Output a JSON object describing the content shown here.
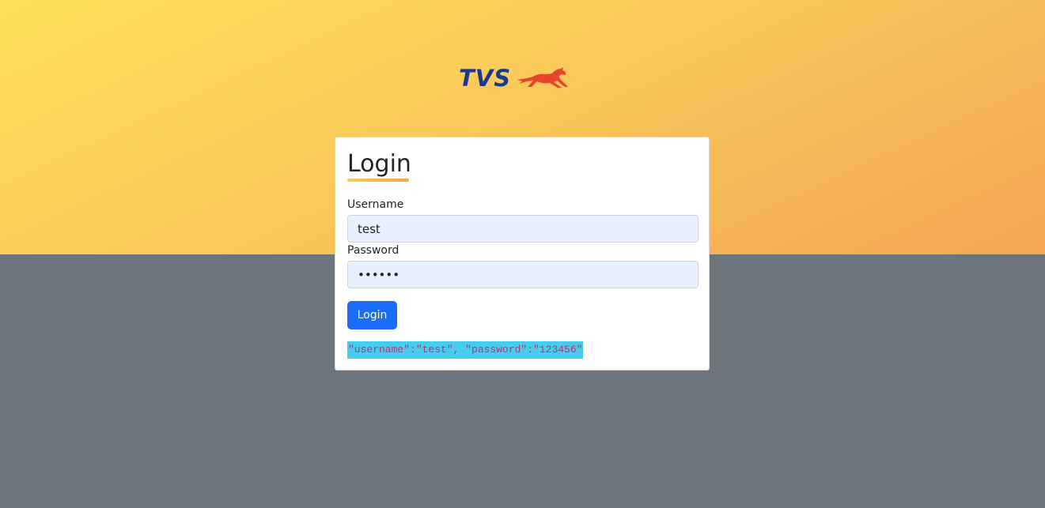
{
  "brand": {
    "logo_text": "TVS",
    "logo_icon": "horse-icon",
    "text_color": "#1a3a8f",
    "icon_color": "#e8442c"
  },
  "colors": {
    "hero_gradient_start": "#ffe057",
    "hero_gradient_end": "#f4a552",
    "page_background": "#6c757d",
    "primary_button": "#1a6ef5",
    "debug_background": "#45cdeb",
    "debug_text": "#c2307a"
  },
  "login": {
    "title": "Login",
    "username_label": "Username",
    "username_value": "test",
    "password_label": "Password",
    "password_value": "123456",
    "button_label": "Login",
    "debug_output": "\"username\":\"test\", \"password\":\"123456\""
  }
}
